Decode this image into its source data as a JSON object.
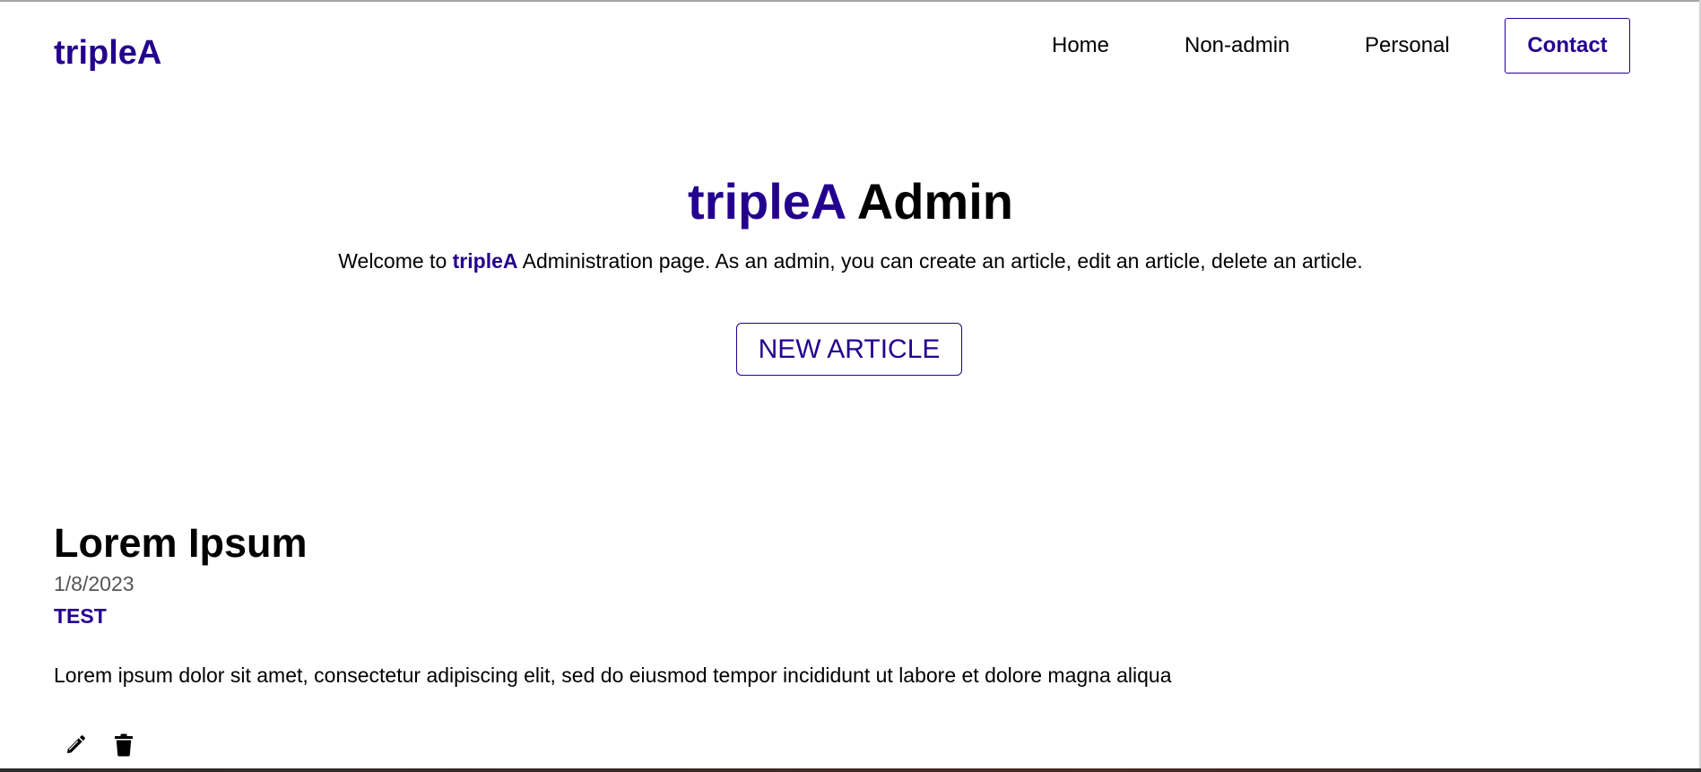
{
  "header": {
    "logo": "tripleA",
    "nav": {
      "home": "Home",
      "non_admin": "Non-admin",
      "personal": "Personal",
      "contact": "Contact"
    }
  },
  "hero": {
    "title_brand": "tripleA",
    "title_rest": "Admin",
    "subtitle_prefix": "Welcome to",
    "subtitle_brand": "tripleA",
    "subtitle_suffix": "Administration page. As an admin, you can create an article, edit an article, delete an article.",
    "new_article_label": "NEW ARTICLE"
  },
  "articles": [
    {
      "title": "Lorem Ipsum",
      "date": "1/8/2023",
      "tag": "TEST",
      "body": "Lorem ipsum dolor sit amet, consectetur adipiscing elit, sed do eiusmod tempor incididunt ut labore et dolore magna aliqua",
      "actions": {
        "edit_icon": "pencil-icon",
        "delete_icon": "trash-icon"
      }
    }
  ],
  "colors": {
    "brand": "#24008e",
    "text": "#000000",
    "muted": "#555555",
    "background": "#ffffff"
  }
}
